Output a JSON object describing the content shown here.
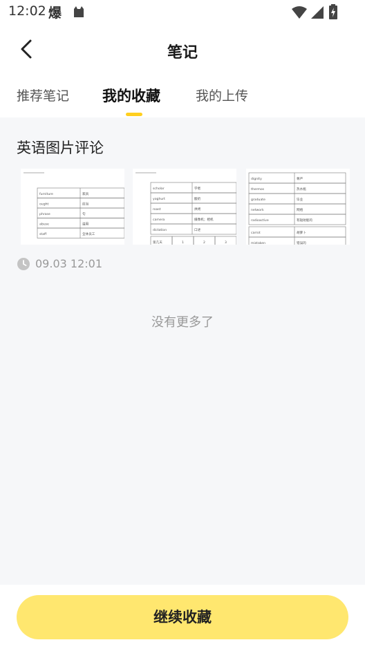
{
  "status_bar": {
    "time": "12:02",
    "app_glyph": "爆"
  },
  "header": {
    "title": "笔记"
  },
  "tabs": [
    {
      "label": "推荐笔记",
      "active": false
    },
    {
      "label": "我的收藏",
      "active": true
    },
    {
      "label": "我的上传",
      "active": false
    }
  ],
  "note": {
    "title": "英语图片评论",
    "timestamp": "09.03 12:01",
    "images": [
      {
        "rows": [
          [
            "furniture",
            "家具"
          ],
          [
            "ought",
            "应当"
          ],
          [
            "phrase",
            "句"
          ],
          [
            "abuse",
            "滥用"
          ],
          [
            "staff",
            "全体员工"
          ]
        ]
      },
      {
        "rows": [
          [
            "scholar",
            "学者"
          ],
          [
            "yoghurt",
            "酸奶"
          ],
          [
            "roast",
            "烘烤"
          ],
          [
            "camera",
            "摄像机；相机"
          ],
          [
            "dictation",
            "口述"
          ]
        ],
        "footer_cells": [
          "第几天",
          "1",
          "2",
          "3"
        ]
      },
      {
        "rows": [
          [
            "dignity",
            "尊严"
          ],
          [
            "thermos",
            "热水瓶"
          ],
          [
            "graduate",
            "毕业"
          ],
          [
            "network",
            "网络"
          ],
          [
            "radioactive",
            "有辐射能的"
          ],
          [
            "carrot",
            "胡萝卜"
          ],
          [
            "mistaken",
            "错误的"
          ]
        ]
      }
    ]
  },
  "list_end_text": "没有更多了",
  "footer": {
    "cta_label": "继续收藏"
  },
  "colors": {
    "accent": "#ffcf1f",
    "cta_bg": "#ffe76f",
    "content_bg": "#f6f7f9"
  }
}
